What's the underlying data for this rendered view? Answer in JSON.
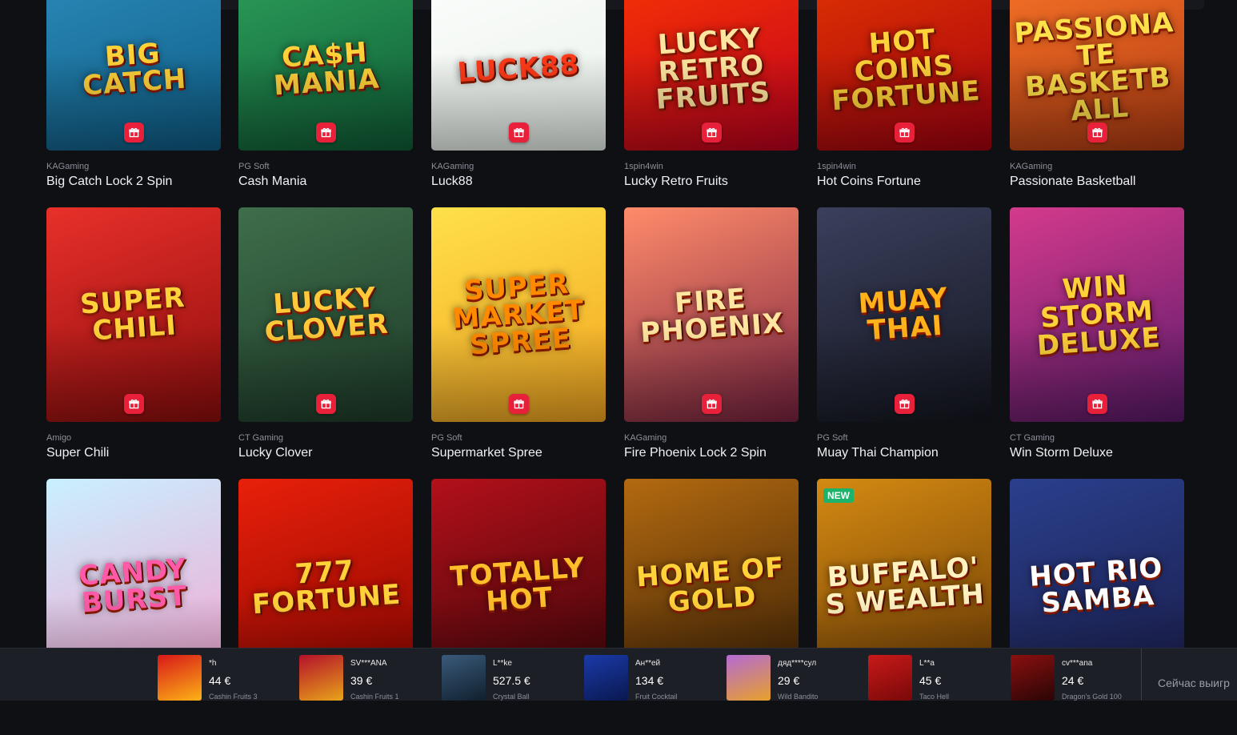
{
  "gift_icon": "gift-icon",
  "rows": [
    [
      {
        "provider": "KAGaming",
        "title": "Big Catch Lock 2 Spin",
        "art": "BIG CATCH",
        "bg": [
          "#2e8fbf",
          "#0e5d86"
        ],
        "artColor": "#ffd23a"
      },
      {
        "provider": "PG Soft",
        "title": "Cash Mania",
        "art": "CA$H Mania",
        "bg": [
          "#2fa55d",
          "#0f5d36"
        ],
        "artColor": "#ffd23a"
      },
      {
        "provider": "KAGaming",
        "title": "Luck88",
        "art": "LUCK88",
        "bg": [
          "#ffffff",
          "#e9f1ea"
        ],
        "artColor": "#ff3a1a"
      },
      {
        "provider": "1spin4win",
        "title": "Lucky Retro Fruits",
        "art": "LUCKY RETRO FRUITS",
        "bg": [
          "#ff3b00",
          "#c0001e"
        ],
        "artColor": "#ffe6a0"
      },
      {
        "provider": "1spin4win",
        "title": "Hot Coins Fortune",
        "art": "HOT COINS FORTUNE",
        "bg": [
          "#e63a00",
          "#a60010"
        ],
        "artColor": "#ffd23a"
      },
      {
        "provider": "KAGaming",
        "title": "Passionate Basketball",
        "art": "Passionate Basketball",
        "bg": [
          "#ff7a2a",
          "#b23b12"
        ],
        "artColor": "#ffe04a"
      }
    ],
    [
      {
        "provider": "Amigo",
        "title": "Super Chili",
        "art": "SUPER CHILI",
        "bg": [
          "#e8302a",
          "#8f0d0d"
        ],
        "artColor": "#ffd23a"
      },
      {
        "provider": "CT Gaming",
        "title": "Lucky Clover",
        "art": "LUCKY CLOVER",
        "bg": [
          "#3f6e4b",
          "#1d3b29"
        ],
        "artColor": "#ffc93a"
      },
      {
        "provider": "PG Soft",
        "title": "Supermarket Spree",
        "art": "SUPER MARKET Spree",
        "bg": [
          "#ffe04a",
          "#f2a520"
        ],
        "artColor": "#ff8a00"
      },
      {
        "provider": "KAGaming",
        "title": "Fire Phoenix Lock 2 Spin",
        "art": "Fire Phoenix",
        "bg": [
          "#ff8b6a",
          "#7a2340"
        ],
        "artColor": "#ffe6a0"
      },
      {
        "provider": "PG Soft",
        "title": "Muay Thai Champion",
        "art": "Muay THAI",
        "bg": [
          "#3a3f5c",
          "#14161f"
        ],
        "artColor": "#ffb21a"
      },
      {
        "provider": "CT Gaming",
        "title": "Win Storm Deluxe",
        "art": "WIN STORM DELUXE",
        "bg": [
          "#d43a8c",
          "#5a1a6a"
        ],
        "artColor": "#ffd23a"
      }
    ],
    [
      {
        "provider": "",
        "title": "",
        "art": "CANDY BURST",
        "bg": [
          "#c9f0ff",
          "#f4a3d0"
        ],
        "artColor": "#ff5aa8"
      },
      {
        "provider": "",
        "title": "",
        "art": "777 FORTUNE",
        "bg": [
          "#e8200a",
          "#8a0500"
        ],
        "artColor": "#ffd23a"
      },
      {
        "provider": "",
        "title": "",
        "art": "TOTALLY HOT",
        "bg": [
          "#b3101a",
          "#3a0508"
        ],
        "artColor": "#ffbf2a"
      },
      {
        "provider": "",
        "title": "",
        "art": "HOME OF GOLD",
        "bg": [
          "#b36a10",
          "#3a1f05"
        ],
        "artColor": "#ffd23a"
      },
      {
        "provider": "",
        "title": "",
        "art": "BUFFALO'S WEALTH",
        "bg": [
          "#d48a12",
          "#6a3a05"
        ],
        "artColor": "#fff1c0",
        "badge": "NEW"
      },
      {
        "provider": "",
        "title": "",
        "art": "HOT RIO SAMBA",
        "bg": [
          "#2a3f8c",
          "#1a1d4a"
        ],
        "artColor": "#ffffff"
      }
    ]
  ],
  "ticker": {
    "label": "Сейчас выигр",
    "wins": [
      {
        "user": "*h",
        "amount": "44 €",
        "game": "Cashin Fruits 3",
        "bg": [
          "#d81818",
          "#fcb316"
        ]
      },
      {
        "user": "SV***ANA",
        "amount": "39 €",
        "game": "Cashin Fruits 1",
        "bg": [
          "#b3102a",
          "#e8a41a"
        ]
      },
      {
        "user": "L**ke",
        "amount": "527.5 €",
        "game": "Crystal Ball",
        "bg": [
          "#3a5a7a",
          "#10202e"
        ]
      },
      {
        "user": "Ан**ей",
        "amount": "134 €",
        "game": "Fruit Cocktail",
        "bg": [
          "#1a3aa8",
          "#0a1850"
        ]
      },
      {
        "user": "дяд****сул",
        "amount": "29 €",
        "game": "Wild Bandito",
        "bg": [
          "#b36ad4",
          "#e8a12a"
        ]
      },
      {
        "user": "L**a",
        "amount": "45 €",
        "game": "Taco Hell",
        "bg": [
          "#c81a1a",
          "#7a0808"
        ]
      },
      {
        "user": "cv***ana",
        "amount": "24 €",
        "game": "Dragon's Gold 100",
        "bg": [
          "#8a1010",
          "#2a0505"
        ]
      }
    ]
  }
}
